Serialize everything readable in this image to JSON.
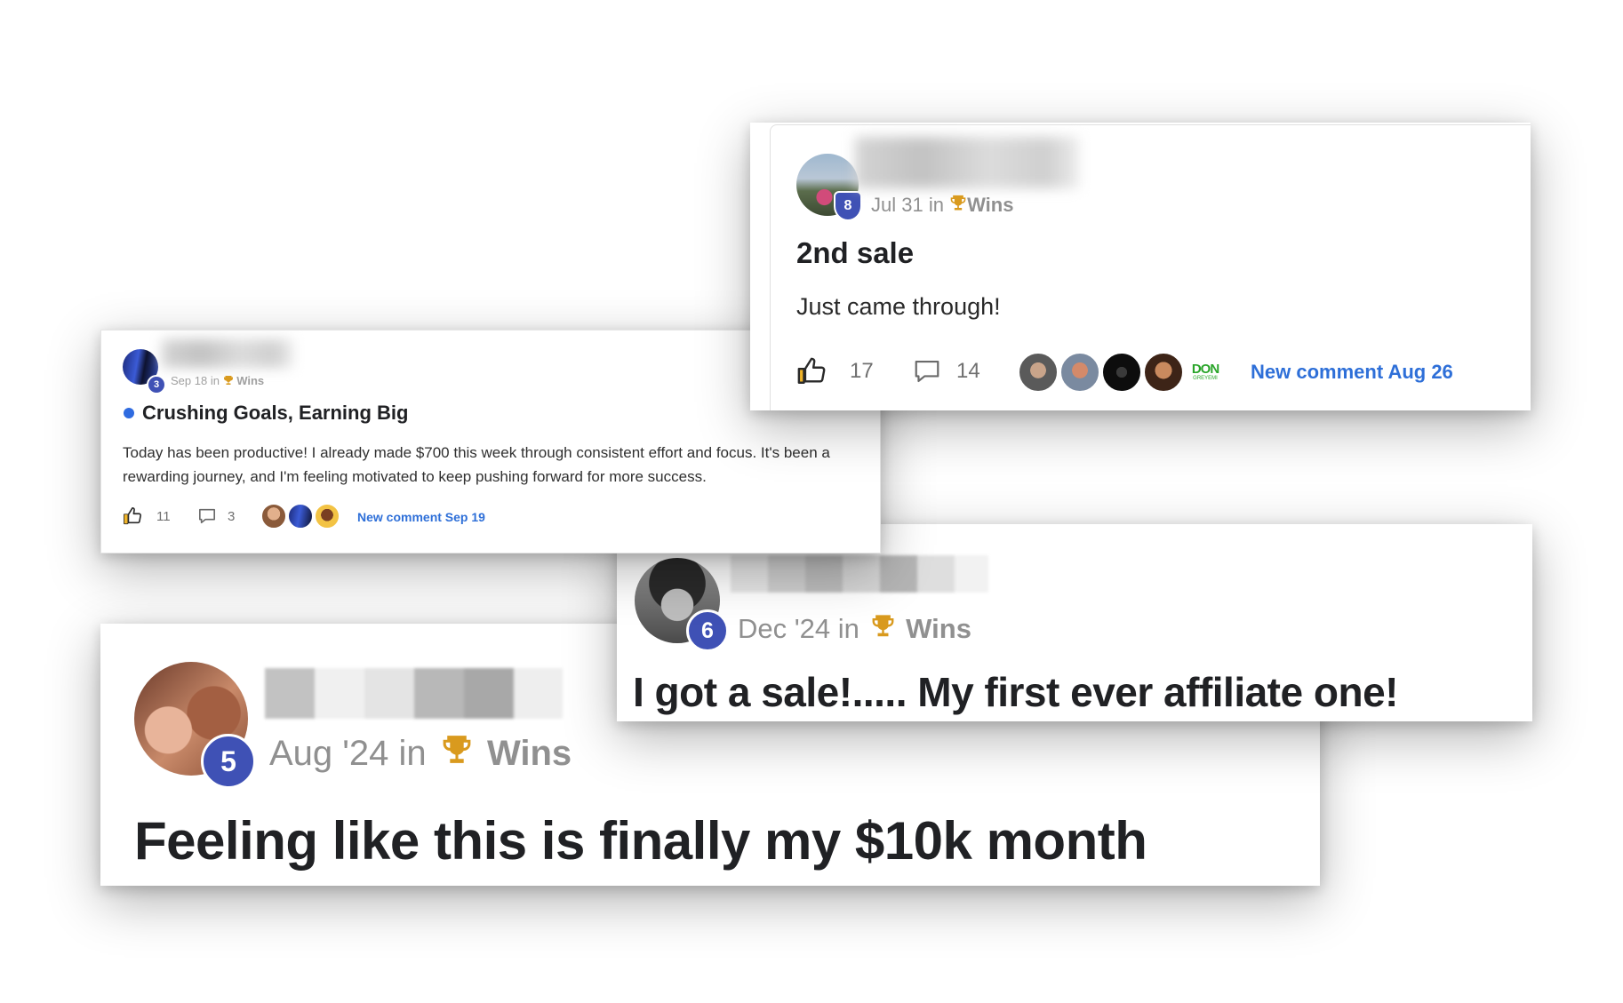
{
  "post_jul31": {
    "level": "8",
    "date": "Jul 31",
    "in_word": "in",
    "category": "Wins",
    "title": "2nd sale",
    "body": "Just came through!",
    "likes": "17",
    "comments": "14",
    "commenter_badge_line1": "DON",
    "commenter_badge_line2": "GREYEMI",
    "new_comment": "New comment Aug 26"
  },
  "post_sep18": {
    "level": "3",
    "date": "Sep 18",
    "in_word": "in",
    "category": "Wins",
    "title": "Crushing Goals, Earning Big",
    "body": "Today has been productive! I already made $700 this week through consistent effort and focus. It's been a rewarding journey, and I'm feeling motivated to keep pushing forward for more success.",
    "likes": "11",
    "comments": "3",
    "new_comment": "New comment Sep 19"
  },
  "post_dec24": {
    "level": "6",
    "date": "Dec '24",
    "in_word": "in",
    "category": "Wins",
    "title": "I got a sale!..... My first ever affiliate one!"
  },
  "post_aug24": {
    "level": "5",
    "date": "Aug '24",
    "in_word": "in",
    "category": "Wins",
    "title": "Feeling like this is finally my $10k month"
  },
  "colors": {
    "level_badge": "#3f51b5",
    "link_blue": "#2e6fd8",
    "unread_dot": "#2f6be0",
    "meta_gray": "#909090",
    "trophy": "#d99a1e"
  },
  "icons": [
    "trophy-icon",
    "thumbs-up-icon",
    "comment-icon"
  ]
}
